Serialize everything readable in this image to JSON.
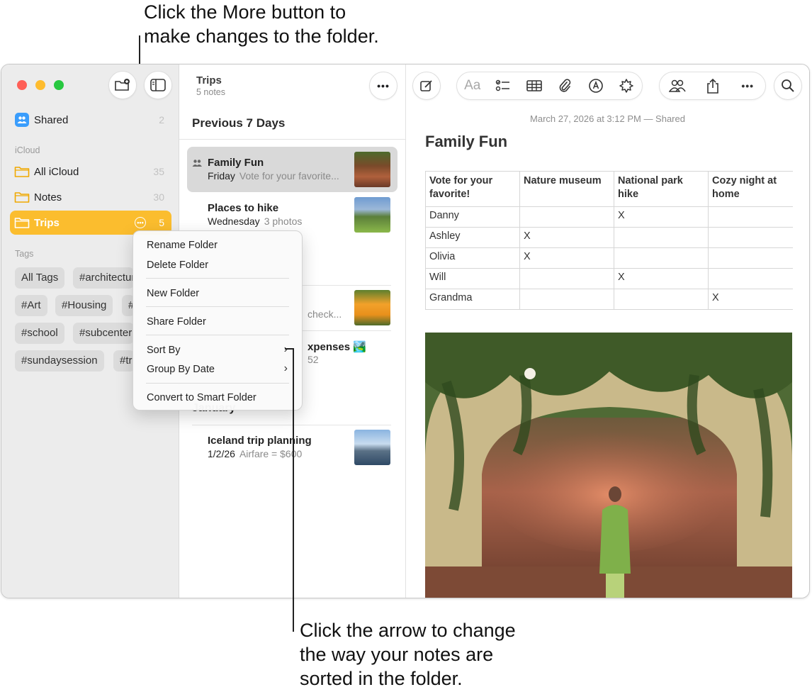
{
  "callouts": {
    "top": [
      "Click the More button to",
      "make changes to the folder."
    ],
    "bottom": [
      "Click the arrow to change",
      "the way your notes are",
      "sorted in the folder."
    ]
  },
  "sidebar": {
    "shared": {
      "label": "Shared",
      "count": "2"
    },
    "icloud_header": "iCloud",
    "folders": [
      {
        "label": "All iCloud",
        "count": "35"
      },
      {
        "label": "Notes",
        "count": "30"
      },
      {
        "label": "Trips",
        "count": "5"
      }
    ],
    "tags_header": "Tags",
    "tags": [
      "All Tags",
      "#architecture",
      "#Art",
      "#Housing",
      "#",
      "#school",
      "#subcenter",
      "#sundaysession",
      "#tr"
    ]
  },
  "notelist": {
    "title": "Trips",
    "subtitle": "5 notes",
    "section_recent": "Previous 7 Days",
    "section_january": "January",
    "notes": [
      {
        "title": "Family Fun",
        "date": "Friday",
        "preview": "Vote for your favorite..."
      },
      {
        "title": "Places to hike",
        "date": "Wednesday",
        "preview": "3 photos"
      },
      {
        "title": "",
        "date": "",
        "preview": "check..."
      },
      {
        "title": "xpenses 🏞️",
        "date": "",
        "preview": "52"
      },
      {
        "title": "Iceland trip planning",
        "date": "1/2/26",
        "preview": "Airfare = $600"
      }
    ]
  },
  "editor": {
    "date_line": "March 27, 2026 at 3:12 PM — Shared",
    "heading": "Family Fun",
    "format_label": "Aa",
    "table": {
      "headers": [
        "Vote for your favorite!",
        "Nature museum",
        "National park hike",
        "Cozy night at home"
      ],
      "rows": [
        [
          "Danny",
          "",
          "X",
          ""
        ],
        [
          "Ashley",
          "X",
          "",
          ""
        ],
        [
          "Olivia",
          "X",
          "",
          ""
        ],
        [
          "Will",
          "",
          "X",
          ""
        ],
        [
          "Grandma",
          "",
          "",
          "X"
        ]
      ]
    }
  },
  "context_menu": {
    "items": [
      "Rename Folder",
      "Delete Folder",
      "New Folder",
      "Share Folder",
      "Sort By",
      "Group By Date",
      "Convert to Smart Folder"
    ]
  },
  "colors": {
    "selected_folder": "#fbbd2e",
    "shared_badge": "#3a9dfc"
  }
}
